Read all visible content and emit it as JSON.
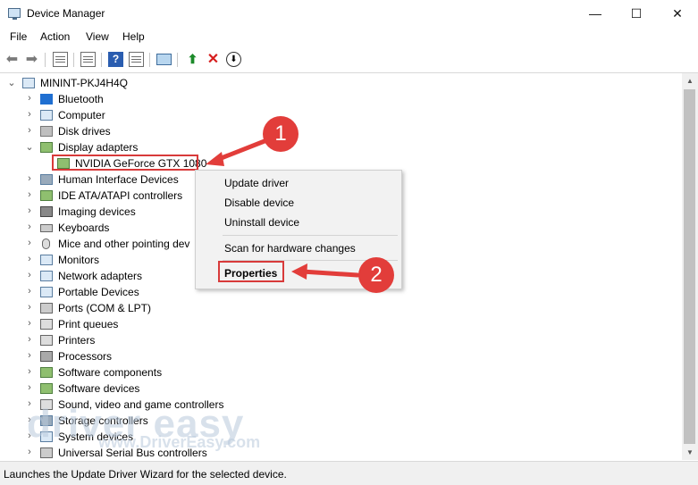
{
  "window": {
    "title": "Device Manager",
    "minimize": "—",
    "maximize": "☐",
    "close": "✕"
  },
  "menu": [
    "File",
    "Action",
    "View",
    "Help"
  ],
  "toolbar": {
    "back_icon": "back-arrow-icon",
    "forward_icon": "forward-arrow-icon",
    "help_glyph": "?",
    "scan_glyph": "⬆",
    "uninstall_glyph": "✕",
    "update_glyph": "⬇"
  },
  "tree": {
    "root": "MININT-PKJ4H4Q",
    "categories": [
      "Bluetooth",
      "Computer",
      "Disk drives",
      "Display adapters",
      "NVIDIA GeForce GTX 1080",
      "Human Interface Devices",
      "IDE ATA/ATAPI controllers",
      "Imaging devices",
      "Keyboards",
      "Mice and other pointing dev",
      "Monitors",
      "Network adapters",
      "Portable Devices",
      "Ports (COM & LPT)",
      "Print queues",
      "Printers",
      "Processors",
      "Software components",
      "Software devices",
      "Sound, video and game controllers",
      "Storage controllers",
      "System devices",
      "Universal Serial Bus controllers"
    ]
  },
  "context_menu": {
    "items": [
      "Update driver",
      "Disable device",
      "Uninstall device",
      "Scan for hardware changes",
      "Properties"
    ]
  },
  "annotations": {
    "step1": "1",
    "step2": "2",
    "accent": "#e23d3a"
  },
  "watermark": {
    "brand": "driver easy",
    "url": "www.DriverEasy.com"
  },
  "status": {
    "text": "Launches the Update Driver Wizard for the selected device."
  }
}
